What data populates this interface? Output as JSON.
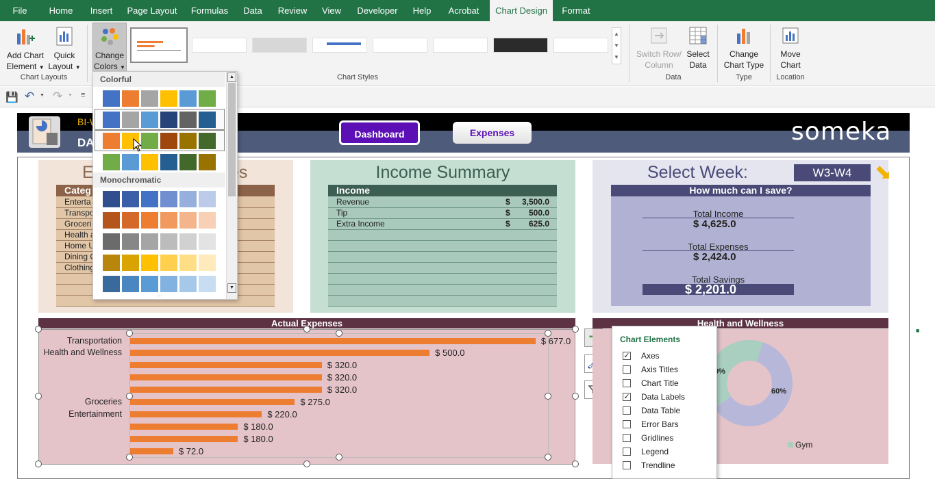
{
  "ribbon": {
    "tabs": [
      "File",
      "Home",
      "Insert",
      "Page Layout",
      "Formulas",
      "Data",
      "Review",
      "View",
      "Developer",
      "Help",
      "Acrobat",
      "Chart Design",
      "Format"
    ],
    "add_chart_element": [
      "Add Chart",
      "Element"
    ],
    "quick_layout": [
      "Quick",
      "Layout"
    ],
    "change_colors": [
      "Change",
      "Colors"
    ],
    "switch_row_col": [
      "Switch Row/",
      "Column"
    ],
    "select_data": [
      "Select",
      "Data"
    ],
    "change_chart_type": [
      "Change",
      "Chart Type"
    ],
    "move_chart": [
      "Move",
      "Chart"
    ],
    "groups": {
      "chart_layouts": "Chart Layouts",
      "chart_styles": "Chart Styles",
      "data": "Data",
      "type": "Type",
      "location": "Location"
    }
  },
  "colors": {
    "ribbon_green": "#217346",
    "bar_orange": "#ed7d31",
    "dashboard_purple": "#5b0fb5",
    "header_slate": "#4f5b7a"
  },
  "dropdown": {
    "colorful_title": "Colorful",
    "mono_title": "Monochromatic",
    "colorful_rows": [
      [
        "#4472c4",
        "#ed7d31",
        "#a5a5a5",
        "#ffc000",
        "#5b9bd5",
        "#70ad47"
      ],
      [
        "#4472c4",
        "#a5a5a5",
        "#5b9bd5",
        "#264478",
        "#636363",
        "#255e91"
      ],
      [
        "#ed7d31",
        "#ffc000",
        "#70ad47",
        "#9e480e",
        "#997300",
        "#43682b"
      ],
      [
        "#70ad47",
        "#5b9bd5",
        "#ffc000",
        "#255e91",
        "#43682b",
        "#997300"
      ]
    ],
    "mono_rows": [
      [
        "#2f4f8f",
        "#3b5ea8",
        "#4472c4",
        "#6f8fd0",
        "#97afdd",
        "#bccbea"
      ],
      [
        "#b4561c",
        "#d4692a",
        "#ed7d31",
        "#f19a5f",
        "#f4b58c",
        "#f8d0b5"
      ],
      [
        "#6b6b6b",
        "#878787",
        "#a5a5a5",
        "#bcbcbc",
        "#d1d1d1",
        "#e3e3e3"
      ],
      [
        "#b8860b",
        "#d9a400",
        "#ffc000",
        "#ffd04d",
        "#ffde85",
        "#ffeabb"
      ],
      [
        "#3a6a9c",
        "#4a86c0",
        "#5b9bd5",
        "#82b3e0",
        "#a7c9e9",
        "#c8ddf2"
      ]
    ]
  },
  "sheet": {
    "brand_short": "BI-W",
    "dash_short": "DA",
    "nav_dashboard": "Dashboard",
    "nav_expenses": "Expenses",
    "logo": "someka",
    "expenses_title_left": "E",
    "expenses_title_right": "es",
    "categ_header": "Categ",
    "categories_visible": [
      "Enterta",
      "Transpo",
      "Groceri",
      "Health a",
      "Home U",
      "Dining C",
      "Clothing"
    ],
    "income_summary": {
      "title": "Income Summary",
      "header": "Income",
      "rows": [
        {
          "label": "Revenue",
          "cur": "$",
          "amount": "3,500.0"
        },
        {
          "label": "Tip",
          "cur": "$",
          "amount": "500.0"
        },
        {
          "label": "Extra Income",
          "cur": "$",
          "amount": "625.0"
        }
      ]
    },
    "select_week": {
      "title": "Select Week:",
      "value": "W3-W4",
      "question": "How much can I save?",
      "total_income_label": "Total Income",
      "total_income": "$  4,625.0",
      "total_expenses_label": "Total Expenses",
      "total_expenses": "$  2,424.0",
      "total_savings_label": "Total Savings",
      "total_savings": "$  2,201.0"
    },
    "actual_expenses_title": "Actual Expenses",
    "health_title": "Health and Wellness",
    "donut_labels": [
      "0%",
      "60%"
    ],
    "donut_legend": "Gym"
  },
  "chart_elements": {
    "title": "Chart Elements",
    "items": [
      {
        "label": "Axes",
        "checked": true
      },
      {
        "label": "Axis Titles",
        "checked": false
      },
      {
        "label": "Chart Title",
        "checked": false
      },
      {
        "label": "Data Labels",
        "checked": true
      },
      {
        "label": "Data Table",
        "checked": false
      },
      {
        "label": "Error Bars",
        "checked": false
      },
      {
        "label": "Gridlines",
        "checked": false
      },
      {
        "label": "Legend",
        "checked": false
      },
      {
        "label": "Trendline",
        "checked": false
      }
    ]
  },
  "chart_data": {
    "type": "bar",
    "title": "Actual Expenses",
    "categories": [
      "Transportation",
      "Health and Wellness",
      "",
      "",
      "",
      "Groceries",
      "Entertainment",
      "",
      "",
      ""
    ],
    "values": [
      677.0,
      500.0,
      320.0,
      320.0,
      320.0,
      275.0,
      220.0,
      180.0,
      180.0,
      72.0
    ],
    "value_labels": [
      "$ 677.0",
      "$ 500.0",
      "$ 320.0",
      "$ 320.0",
      "$ 320.0",
      "$ 275.0",
      "$ 220.0",
      "$ 180.0",
      "$ 180.0",
      "$ 72.0"
    ],
    "xlim": [
      0,
      700
    ],
    "orientation": "horizontal",
    "color": "#ed7d31"
  }
}
